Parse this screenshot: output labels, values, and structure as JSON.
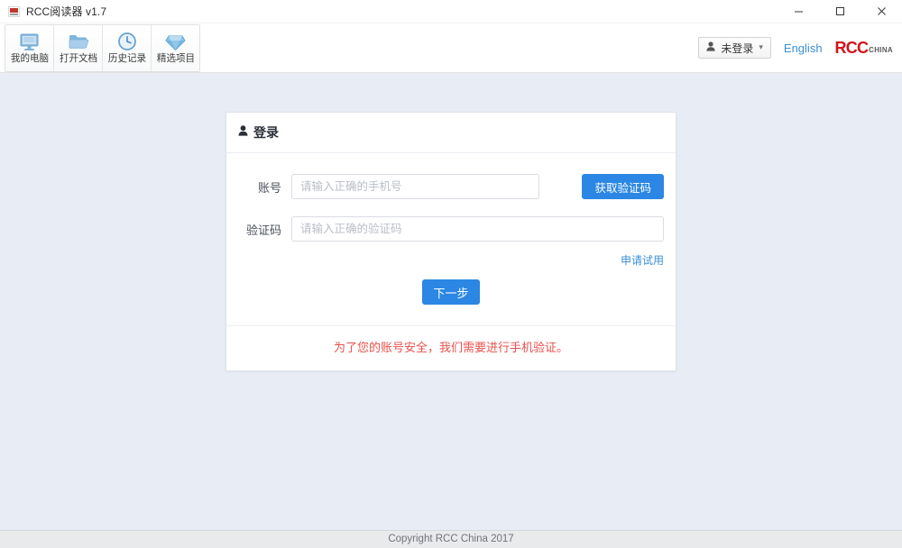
{
  "window": {
    "title": "RCC阅读器 v1.7",
    "app_icon": "rcc-app-icon",
    "minimize_label": "—",
    "maximize_label": "□",
    "close_label": "✕"
  },
  "toolbar": {
    "items": [
      {
        "label": "我的电脑",
        "icon": "monitor-icon"
      },
      {
        "label": "打开文档",
        "icon": "folder-icon"
      },
      {
        "label": "历史记录",
        "icon": "clock-icon"
      },
      {
        "label": "精选项目",
        "icon": "diamond-icon"
      }
    ],
    "user_button": {
      "label": "未登录",
      "icon": "user-icon",
      "caret": "▾"
    },
    "language_link": "English",
    "brand": {
      "primary": "RCC",
      "secondary": "CHINA"
    }
  },
  "login_card": {
    "header": {
      "icon": "user-icon",
      "title": "登录"
    },
    "fields": [
      {
        "label": "账号",
        "placeholder": "请输入正确的手机号",
        "value": ""
      },
      {
        "label": "验证码",
        "placeholder": "请输入正确的验证码",
        "value": ""
      }
    ],
    "get_code_button": "获取验证码",
    "trial_link": "申请试用",
    "submit_button": "下一步",
    "warning": "为了您的账号安全，我们需要进行手机验证。"
  },
  "statusbar": {
    "copyright": "Copyright RCC China 2017"
  },
  "colors": {
    "accent_blue": "#2b87e3",
    "link_blue": "#3b8fd6",
    "warning_red": "#e8514d",
    "brand_red": "#d4121a",
    "page_background": "#e7ecf5"
  }
}
